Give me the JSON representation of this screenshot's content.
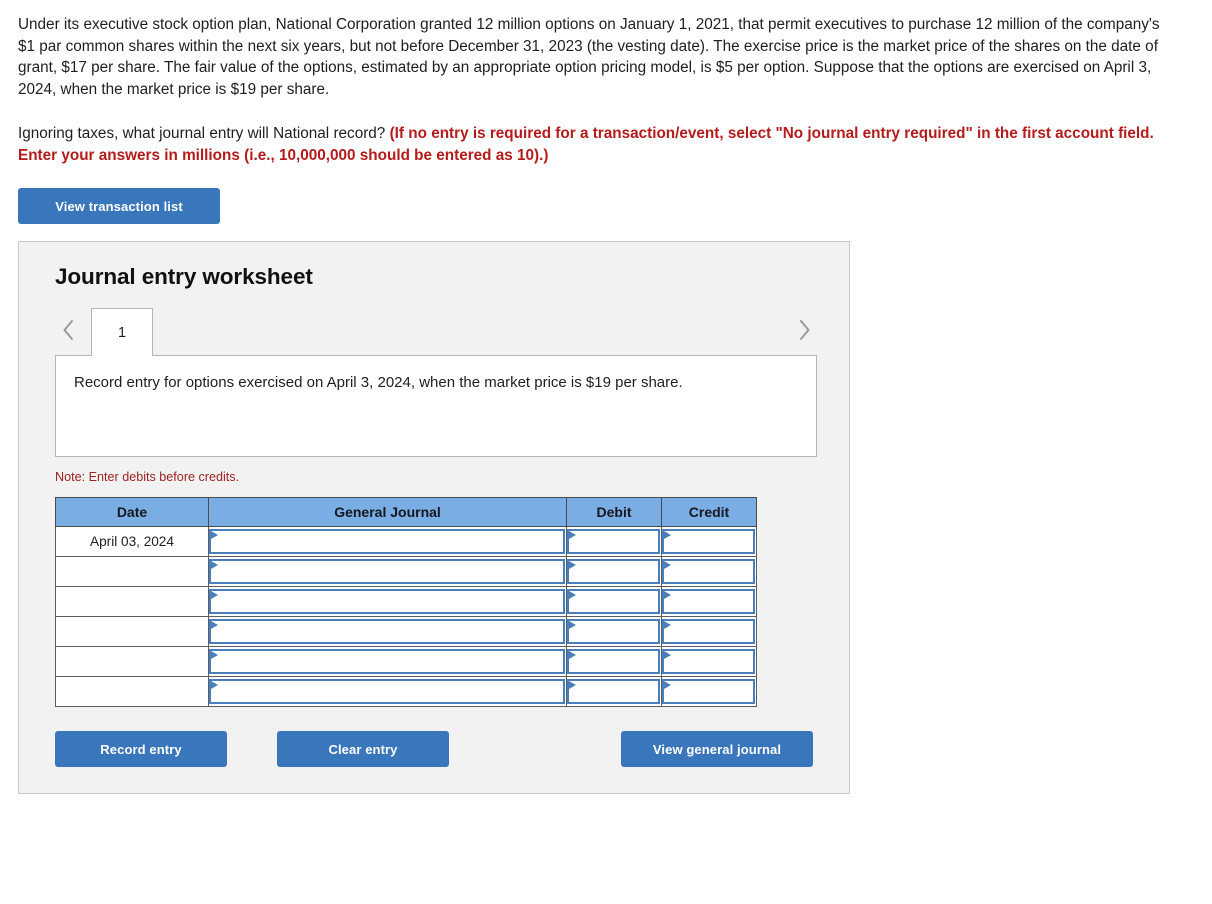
{
  "problem": {
    "paragraph1": "Under its executive stock option plan, National Corporation granted 12 million options on January 1, 2021, that permit executives to purchase 12 million of the company's $1 par common shares within the next six years, but not before December 31, 2023 (the vesting date). The exercise price is the market price of the shares on the date of grant, $17 per share. The fair value of the options, estimated by an appropriate option pricing model, is $5 per option. Suppose that the options are exercised on April 3, 2024, when the market price is $19 per share.",
    "paragraph2_plain": "Ignoring taxes, what journal entry will National record? ",
    "paragraph2_emphasis": "(If no entry is required for a transaction/event, select \"No journal entry required\" in the first account field. Enter your answers in millions (i.e., 10,000,000 should be entered as 10).)"
  },
  "toolbar": {
    "view_transaction_list_label": "View transaction list"
  },
  "worksheet": {
    "title": "Journal entry worksheet",
    "prev_icon": "chevron-left-icon",
    "next_icon": "chevron-right-icon",
    "tabs": [
      {
        "label": "1",
        "active": true
      }
    ],
    "instruction": "Record entry for options exercised on April 3, 2024, when the market price is $19 per share.",
    "note": "Note: Enter debits before credits."
  },
  "journal_table": {
    "headers": [
      "Date",
      "General Journal",
      "Debit",
      "Credit"
    ],
    "rows": [
      {
        "date": "April 03, 2024",
        "general_journal": "",
        "debit": "",
        "credit": ""
      },
      {
        "date": "",
        "general_journal": "",
        "debit": "",
        "credit": ""
      },
      {
        "date": "",
        "general_journal": "",
        "debit": "",
        "credit": ""
      },
      {
        "date": "",
        "general_journal": "",
        "debit": "",
        "credit": ""
      },
      {
        "date": "",
        "general_journal": "",
        "debit": "",
        "credit": ""
      },
      {
        "date": "",
        "general_journal": "",
        "debit": "",
        "credit": ""
      }
    ]
  },
  "footer": {
    "record_entry_label": "Record entry",
    "clear_entry_label": "Clear entry",
    "view_general_journal_label": "View general journal"
  },
  "colors": {
    "button_blue": "#3a76bb",
    "table_header_blue": "#79ade4",
    "select_border_blue": "#4a7fbe",
    "emphasis_red": "#b51b1b",
    "note_red": "#9d2222",
    "panel_background": "#f2f2f2",
    "panel_border": "#c9c9c9"
  }
}
